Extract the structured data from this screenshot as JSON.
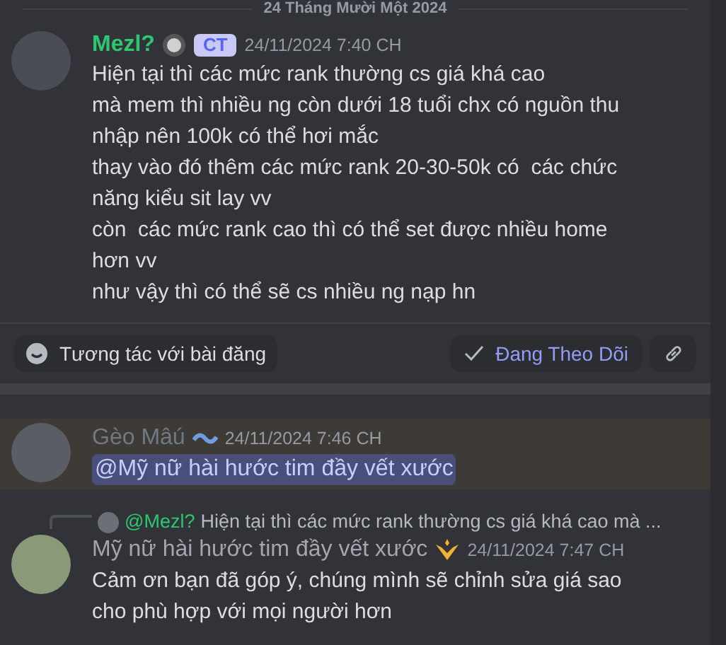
{
  "date_divider": "24 Tháng Mười Một 2024",
  "post": {
    "author": "Mezl?",
    "tag": "CT",
    "time": "24/11/2024 7:40 CH",
    "lines": [
      "Hiện tại thì các mức rank thường cs giá khá cao",
      "mà mem thì nhiều ng còn dưới 18 tuổi chx có nguồn thu nhập nên 100k có thể hơi mắc",
      "thay vào đó thêm các mức rank 20-30-50k có  các chức năng kiểu sit lay vv",
      "còn  các mức rank cao thì có thể set được nhiều home hơn vv",
      "như vậy thì có thể sẽ cs nhiều ng nạp hn"
    ],
    "react_button": "Tương tác với bài đăng",
    "follow_button": {
      "label": "Đang Theo Dõi",
      "on": true
    }
  },
  "messages": [
    {
      "kind": "mention",
      "author": "Gèo Mâú",
      "time": "24/11/2024 7:46 CH",
      "highlighted": true,
      "mention": "@Mỹ nữ hài hước tim đầy vết xước"
    },
    {
      "kind": "reply",
      "author": "Mỹ nữ hài hước tim đầy vết xước",
      "time": "24/11/2024 7:47 CH",
      "highlighted": false,
      "reply_to": "@Mezl?",
      "reply_preview": "Hiện tại thì các mức rank thường cs giá khá cao mà ...",
      "lines": [
        "Cảm ơn bạn đã góp ý, chúng mình sẽ chỉnh sửa giá sao",
        "cho phù hợp với mọi người hơn"
      ]
    }
  ]
}
